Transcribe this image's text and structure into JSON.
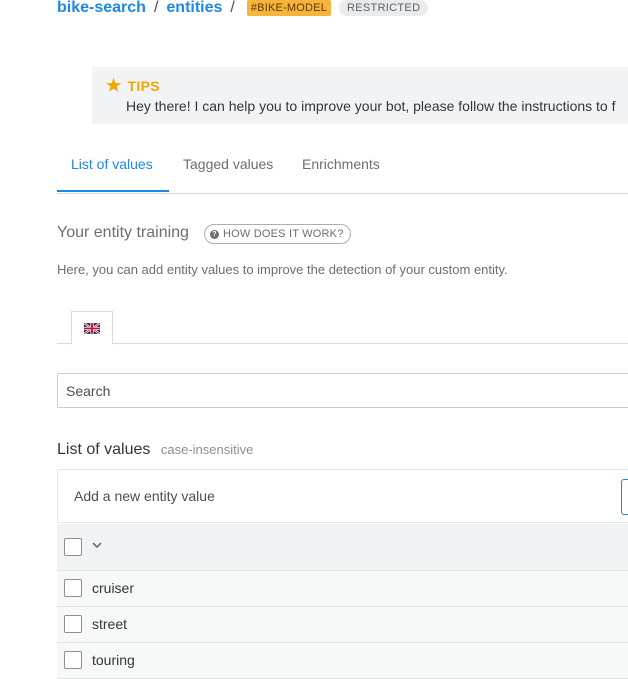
{
  "breadcrumb": {
    "bot": "bike-search",
    "separator": "/",
    "section": "entities",
    "entity_tag": "#BIKE-MODEL",
    "visibility": "RESTRICTED"
  },
  "tips": {
    "title": "TIPS",
    "icon": "star-icon",
    "text": "Hey there! I can help you to improve your bot, please follow the instructions to f"
  },
  "tabs": [
    {
      "label": "List of values",
      "active": true
    },
    {
      "label": "Tagged values",
      "active": false
    },
    {
      "label": "Enrichments",
      "active": false
    }
  ],
  "training": {
    "title": "Your entity training",
    "help_button": "HOW DOES IT WORK?",
    "description": "Here, you can add entity values to improve the detection of your custom entity."
  },
  "language": {
    "selected": "en",
    "icon": "uk-flag-icon"
  },
  "search": {
    "placeholder": "Search"
  },
  "values_list": {
    "title": "List of values",
    "subtitle": "case-insensitive",
    "add_placeholder": "Add a new entity value",
    "items": [
      {
        "label": "cruiser",
        "checked": false
      },
      {
        "label": "street",
        "checked": false
      },
      {
        "label": "touring",
        "checked": false
      }
    ]
  },
  "colors": {
    "accent": "#1e88e5",
    "tips_title": "#f0a800",
    "entity_tag_bg": "#f6b43a",
    "restricted_bg": "#e9ebed"
  }
}
